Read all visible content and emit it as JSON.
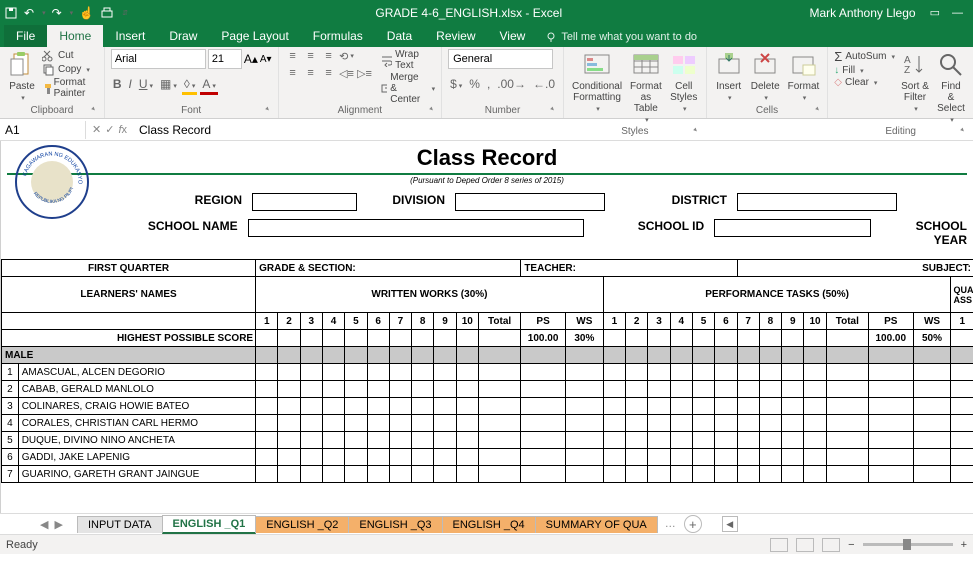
{
  "titlebar": {
    "filename": "GRADE 4-6_ENGLISH.xlsx - Excel",
    "user": "Mark Anthony Llego"
  },
  "tabs": {
    "file": "File",
    "home": "Home",
    "insert": "Insert",
    "draw": "Draw",
    "page_layout": "Page Layout",
    "formulas": "Formulas",
    "data": "Data",
    "review": "Review",
    "view": "View",
    "tellme": "Tell me what you want to do"
  },
  "ribbon": {
    "clipboard": {
      "label": "Clipboard",
      "paste": "Paste",
      "cut": "Cut",
      "copy": "Copy",
      "format_painter": "Format Painter"
    },
    "font": {
      "label": "Font",
      "name": "Arial",
      "size": "21"
    },
    "alignment": {
      "label": "Alignment",
      "wrap": "Wrap Text",
      "merge": "Merge & Center"
    },
    "number": {
      "label": "Number",
      "format": "General"
    },
    "styles": {
      "label": "Styles",
      "conditional": "Conditional\nFormatting",
      "format_as": "Format as\nTable",
      "cell": "Cell\nStyles"
    },
    "cells": {
      "label": "Cells",
      "insert": "Insert",
      "delete": "Delete",
      "format": "Format"
    },
    "editing": {
      "label": "Editing",
      "autosum": "AutoSum",
      "fill": "Fill",
      "clear": "Clear",
      "sort": "Sort &\nFilter",
      "find": "Find &\nSelect"
    }
  },
  "formula_bar": {
    "cell": "A1",
    "value": "Class Record"
  },
  "doc": {
    "title": "Class Record",
    "subtitle": "(Pursuant to Deped Order 8 series of 2015)",
    "seal_top": "KAGAWARAN NG EDUKASYON",
    "seal_bottom": "REPUBLIKA NG PILIPINAS",
    "labels": {
      "region": "REGION",
      "division": "DIVISION",
      "district": "DISTRICT",
      "school_name": "SCHOOL NAME",
      "school_id": "SCHOOL ID",
      "school_year": "SCHOOL YEAR"
    },
    "row_labels": {
      "quarter": "FIRST QUARTER",
      "grade_section": "GRADE & SECTION:",
      "teacher": "TEACHER:",
      "subject": "SUBJECT:",
      "learners": "LEARNERS' NAMES",
      "written": "WRITTEN WORKS (30%)",
      "performance": "PERFORMANCE TASKS (50%)",
      "qa": "QUARTERLY ASSESSMENT",
      "hps": "HIGHEST POSSIBLE SCORE",
      "male": "MALE",
      "total": "Total",
      "ps": "PS",
      "ws": "WS"
    },
    "cols": [
      "1",
      "2",
      "3",
      "4",
      "5",
      "6",
      "7",
      "8",
      "9",
      "10"
    ],
    "hps_ww_ps": "100.00",
    "hps_ww_ws": "30%",
    "hps_pt_ps": "100.00",
    "hps_pt_ws": "50%",
    "students": [
      "AMASCUAL, ALCEN DEGORIO",
      "CABAB, GERALD MANLOLO",
      "COLINARES, CRAIG HOWIE BATEO",
      "CORALES, CHRISTIAN CARL HERMO",
      "DUQUE, DIVINO NINO ANCHETA",
      "GADDI, JAKE LAPENIG",
      "GUARINO, GARETH GRANT JAINGUE"
    ]
  },
  "sheet_tabs": {
    "t1": "INPUT DATA",
    "t2": "ENGLISH _Q1",
    "t3": "ENGLISH _Q2",
    "t4": "ENGLISH _Q3",
    "t5": "ENGLISH _Q4",
    "t6": "SUMMARY OF QUA"
  },
  "status": {
    "ready": "Ready"
  }
}
